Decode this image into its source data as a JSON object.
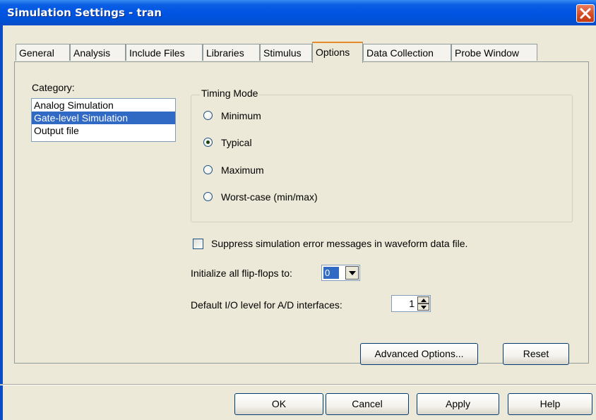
{
  "window": {
    "title": "Simulation Settings - tran",
    "close_icon": "close-icon"
  },
  "tabs": [
    {
      "label": "General"
    },
    {
      "label": "Analysis"
    },
    {
      "label": "Include Files"
    },
    {
      "label": "Libraries"
    },
    {
      "label": "Stimulus"
    },
    {
      "label": "Options"
    },
    {
      "label": "Data Collection"
    },
    {
      "label": "Probe Window"
    }
  ],
  "active_tab": "Options",
  "category": {
    "label": "Category:",
    "items": [
      {
        "label": "Analog Simulation"
      },
      {
        "label": "Gate-level Simulation"
      },
      {
        "label": "Output file"
      }
    ],
    "selected": "Gate-level Simulation"
  },
  "timing_mode": {
    "label": "Timing Mode",
    "options": [
      {
        "label": "Minimum"
      },
      {
        "label": "Typical"
      },
      {
        "label": "Maximum"
      },
      {
        "label": "Worst-case (min/max)"
      }
    ],
    "selected": "Typical"
  },
  "suppress": {
    "label": "Suppress simulation error messages in waveform data file.",
    "checked": false
  },
  "flipflops": {
    "label": "Initialize all flip-flops to:",
    "value": "0"
  },
  "io_level": {
    "label": "Default I/O level for A/D interfaces:",
    "value": "1"
  },
  "buttons": {
    "advanced": "Advanced Options...",
    "reset": "Reset",
    "ok": "OK",
    "cancel": "Cancel",
    "apply": "Apply",
    "help": "Help"
  },
  "colors": {
    "titlebar": "#0054e3",
    "selection": "#316ac5",
    "active_tab_accent": "#e68b2c",
    "dialog_bg": "#ece9d8"
  }
}
